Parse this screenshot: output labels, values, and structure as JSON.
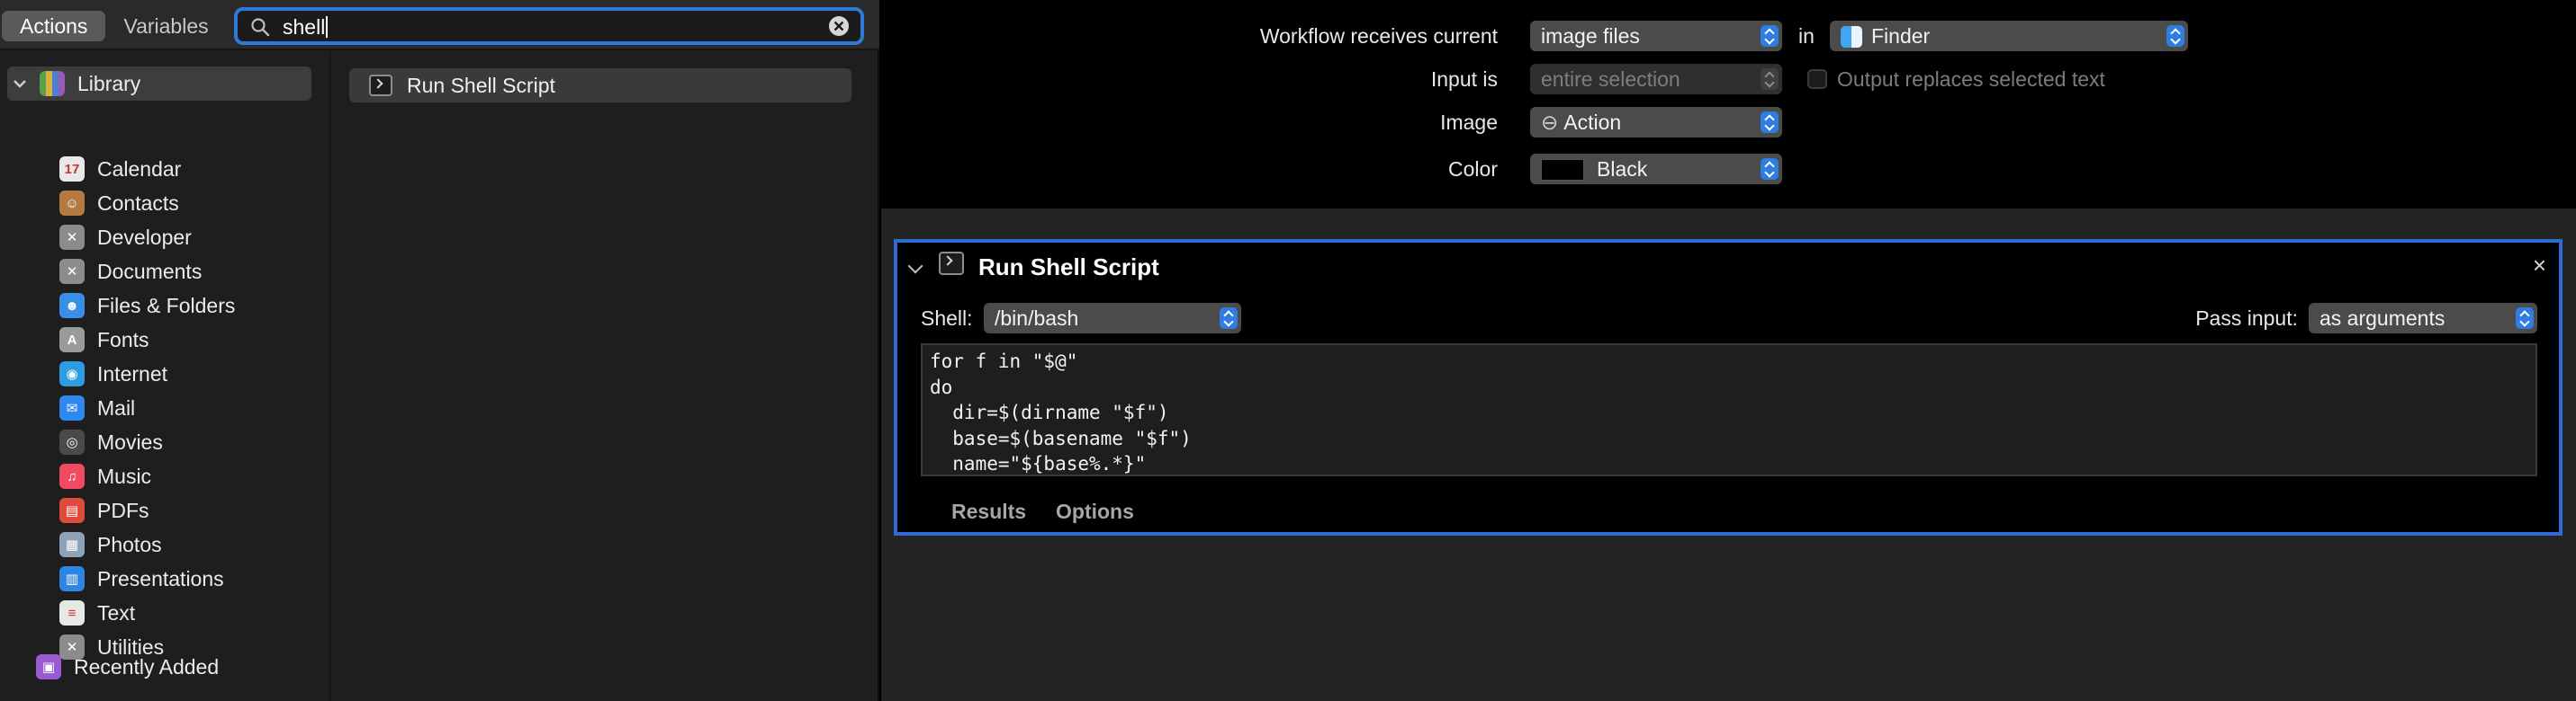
{
  "topbar": {
    "tabs": [
      "Actions",
      "Variables"
    ],
    "search_value": "shell"
  },
  "library": {
    "root_label": "Library",
    "items": [
      {
        "label": "Calendar",
        "icon": "calendar-icon",
        "color": "#e8e8e8"
      },
      {
        "label": "Contacts",
        "icon": "contacts-icon",
        "color": "#b47a3f"
      },
      {
        "label": "Developer",
        "icon": "developer-tools-icon",
        "color": "#8c8c8c"
      },
      {
        "label": "Documents",
        "icon": "documents-tools-icon",
        "color": "#8c8c8c"
      },
      {
        "label": "Files & Folders",
        "icon": "finder-icon",
        "color": "#3a8ee6"
      },
      {
        "label": "Fonts",
        "icon": "fonts-icon",
        "color": "#9a9a9a"
      },
      {
        "label": "Internet",
        "icon": "internet-icon",
        "color": "#2d9de0"
      },
      {
        "label": "Mail",
        "icon": "mail-icon",
        "color": "#2f88ee"
      },
      {
        "label": "Movies",
        "icon": "movies-icon",
        "color": "#4a4a4a"
      },
      {
        "label": "Music",
        "icon": "music-icon",
        "color": "#f24a64"
      },
      {
        "label": "PDFs",
        "icon": "pdf-icon",
        "color": "#e04b3b"
      },
      {
        "label": "Photos",
        "icon": "photos-icon",
        "color": "#8fa3b8"
      },
      {
        "label": "Presentations",
        "icon": "presentations-icon",
        "color": "#2e86e0"
      },
      {
        "label": "Text",
        "icon": "text-icon",
        "color": "#e8e8e8"
      },
      {
        "label": "Utilities",
        "icon": "utilities-icon",
        "color": "#8c8c8c"
      }
    ],
    "recently_added": "Recently Added"
  },
  "search_results": [
    {
      "label": "Run Shell Script"
    }
  ],
  "workflow": {
    "receives_label": "Workflow receives current",
    "receives_value": "image files",
    "in_label": "in",
    "app_value": "Finder",
    "input_is_label": "Input is",
    "input_is_value": "entire selection",
    "output_replaces_label": "Output replaces selected text",
    "image_label": "Image",
    "image_value": "Action",
    "color_label": "Color",
    "color_value": "Black"
  },
  "action_card": {
    "title": "Run Shell Script",
    "close_glyph": "×",
    "shell_label": "Shell:",
    "shell_value": "/bin/bash",
    "pass_input_label": "Pass input:",
    "pass_input_value": "as arguments",
    "script": "for f in \"$@\"\ndo\n  dir=$(dirname \"$f\")\n  base=$(basename \"$f\")\n  name=\"${base%.*}\"",
    "tabs": [
      "Results",
      "Options"
    ]
  },
  "colors": {
    "accent": "#2e7bd6",
    "popup_stepper": "#2f7de0"
  }
}
